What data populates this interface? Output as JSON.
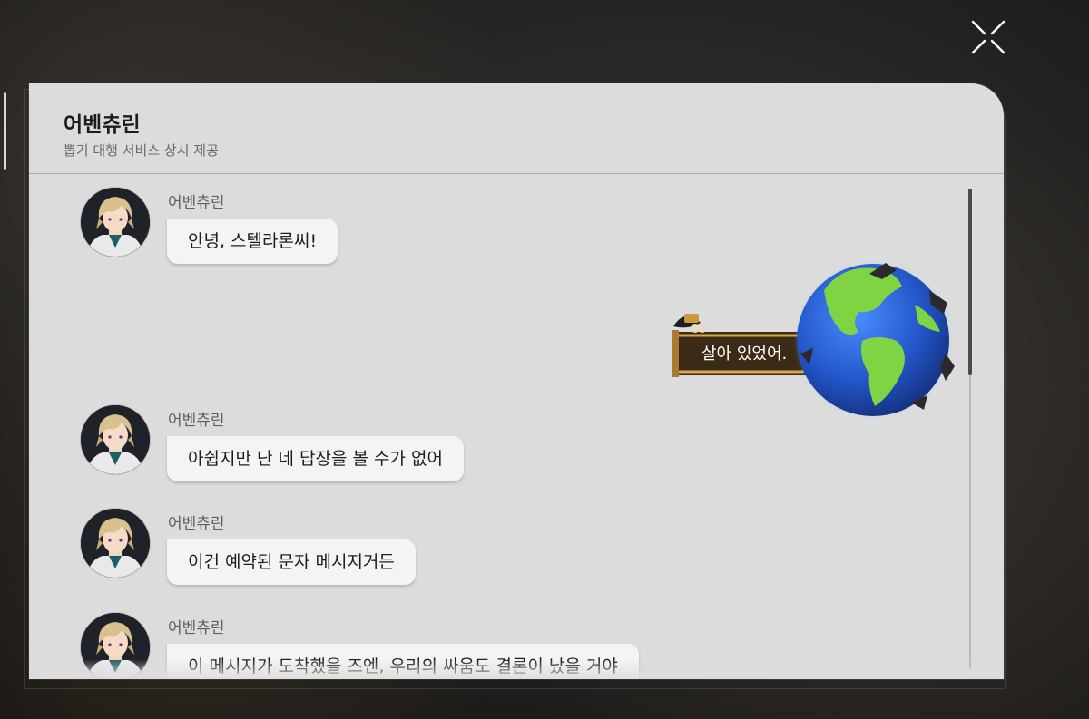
{
  "chat": {
    "contact_name": "어벤츄린",
    "contact_status": "뽑기 대행 서비스 상시 제공"
  },
  "messages": [
    {
      "sender": "어벤츄린",
      "text": "안녕, 스텔라론씨!"
    },
    {
      "sender": "어벤츄린",
      "text": "아쉽지만 난 네 답장을 볼 수가 없어"
    },
    {
      "sender": "어벤츄린",
      "text": "이건 예약된 문자 메시지거든"
    },
    {
      "sender": "어벤츄린",
      "text": "이 메시지가 도착했을 즈엔, 우리의 싸움도 결론이 났을 거야"
    }
  ],
  "sticker": {
    "text": "살아 있었어.",
    "icon": "globe-sticker-icon"
  },
  "icons": {
    "close": "close-icon",
    "avatar": "avatar-portrait-icon"
  },
  "colors": {
    "panel_bg": "#dcdcdc",
    "bubble_bg": "#f4f4f4",
    "text_primary": "#1d1d1d",
    "text_secondary": "#6a6a6a"
  }
}
